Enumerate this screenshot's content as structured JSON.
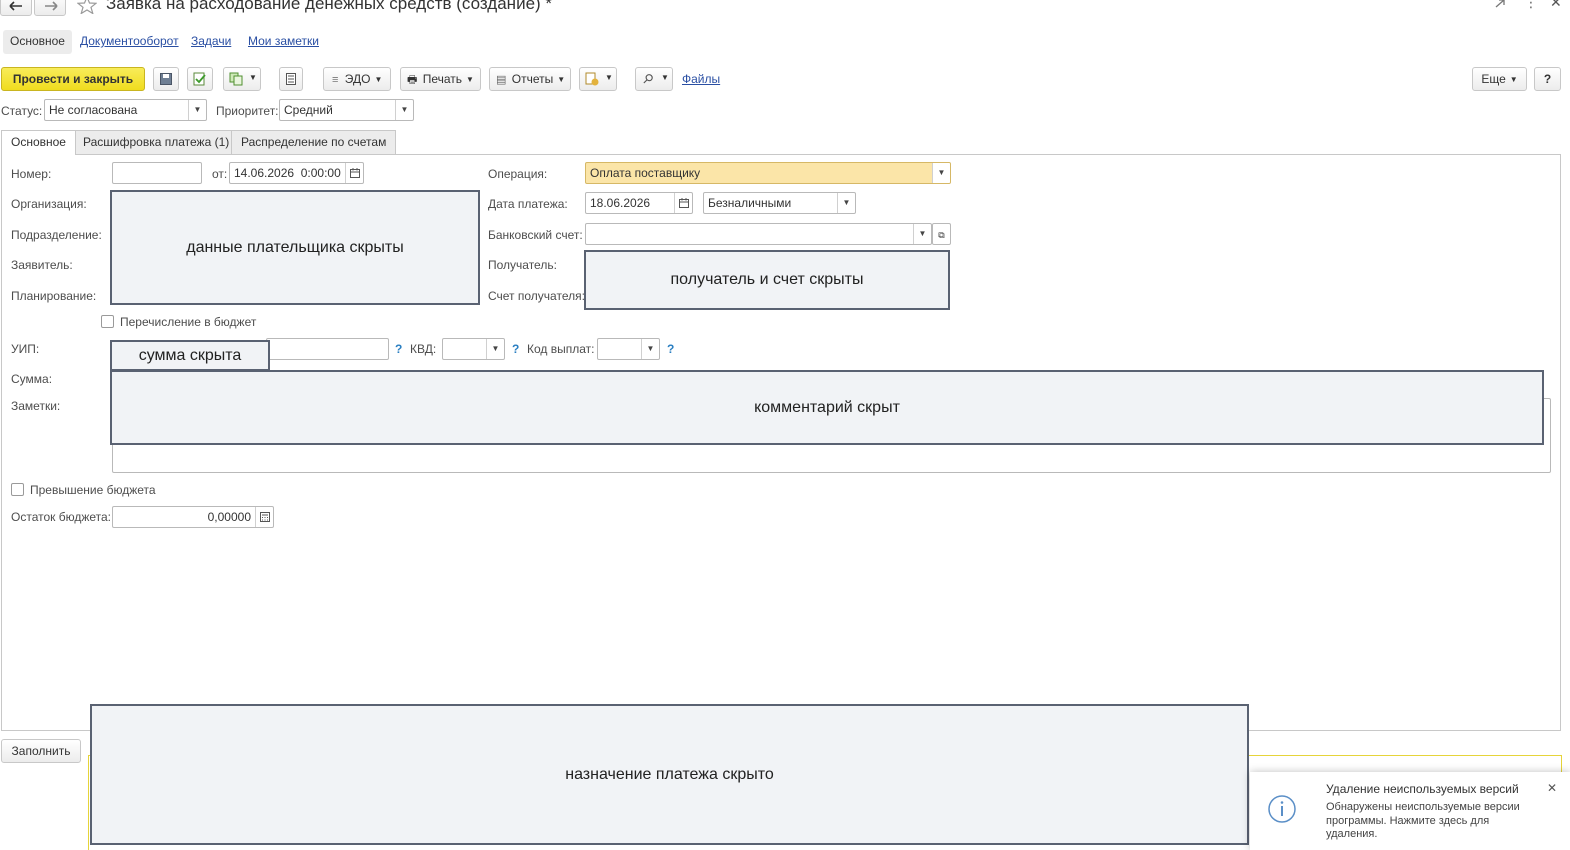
{
  "window": {
    "title": "Заявка на расходование денежных средств (создание) *"
  },
  "nav": {
    "items": [
      "Основное",
      "Документооборот",
      "Задачи",
      "Мои заметки"
    ]
  },
  "toolbar": {
    "post_close": "Провести и закрыть",
    "edo": "ЭДО",
    "print": "Печать",
    "reports": "Отчеты",
    "files": "Файлы",
    "more": "Еще",
    "help": "?"
  },
  "status_row": {
    "status_label": "Статус:",
    "status_value": "Не согласована",
    "priority_label": "Приоритет:",
    "priority_value": "Средний"
  },
  "tabs": [
    "Основное",
    "Расшифровка платежа (1)",
    "Распределение по счетам"
  ],
  "form": {
    "number_label": "Номер:",
    "number_value": "",
    "from_label": "от:",
    "date_value": "14.06.2026  0:00:00",
    "org_label": "Организация:",
    "subdivision_label": "Подразделение:",
    "applicant_label": "Заявитель:",
    "planning_label": "Планирование:",
    "budget_transfer_label": "Перечисление в бюджет",
    "uip_label": "УИП:",
    "kvd_label": "КВД:",
    "payout_code_label": "Код выплат:",
    "sum_label": "Сумма:",
    "notes_label": "Заметки:",
    "operation_label": "Операция:",
    "operation_value": "Оплата поставщику",
    "pay_date_label": "Дата платежа:",
    "pay_date_value": "18.06.2026",
    "pay_type_value": "Безналичными",
    "bank_account_label": "Банковский счет:",
    "recipient_label": "Получатель:",
    "recipient_account_label": "Счет получателя:",
    "budget_overrun_label": "Превышение бюджета",
    "budget_rest_label": "Остаток бюджета:",
    "budget_rest_value": "0,00000"
  },
  "covers": {
    "payer": "данные плательщика скрыты",
    "recipient": "получатель и счет скрыты",
    "sum": "сумма скрыта",
    "comment": "комментарий скрыт",
    "purpose": "назначение платежа скрыто"
  },
  "bottom": {
    "fill_button": "Заполнить"
  },
  "notification": {
    "title": "Удаление неиспользуемых версий",
    "text": "Обнаружены неиспользуемые версии программы. Нажмите здесь для удаления."
  },
  "colors": {
    "primary_button": "#f5e43a",
    "operation_field": "#fbe5a8",
    "link": "#2a4fa3",
    "info_icon": "#5b8fc7"
  }
}
